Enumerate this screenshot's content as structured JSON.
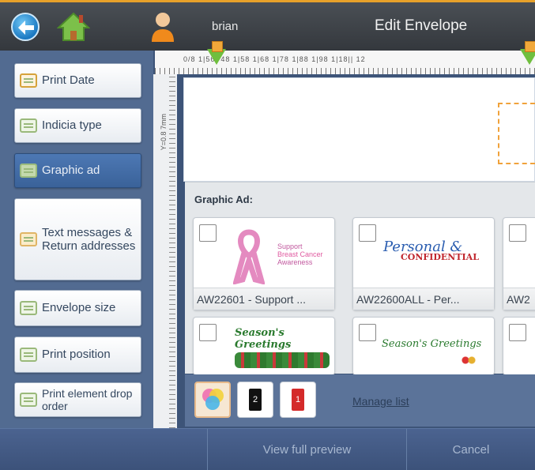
{
  "header": {
    "username": "brian",
    "title": "Edit Envelope"
  },
  "sidebar": {
    "items": [
      {
        "label": "Print Date",
        "icon": "calendar-icon"
      },
      {
        "label": "Indicia type",
        "icon": "indicia-icon"
      },
      {
        "label": "Graphic ad",
        "icon": "graphic-icon",
        "active": true
      },
      {
        "label": "Text messages & Return addresses",
        "icon": "text-icon"
      },
      {
        "label": "Envelope size",
        "icon": "envelope-icon"
      },
      {
        "label": "Print position",
        "icon": "position-icon"
      },
      {
        "label": "Print element drop order",
        "icon": "order-icon"
      }
    ]
  },
  "ruler": {
    "top_text": "0/8 1|56.  48 1|58 1|68 1|78 1|88 1|98  1|18|| 12",
    "left_text": "Y=0.8 7mm"
  },
  "graphic_panel": {
    "title": "Graphic Ad:",
    "cards": [
      {
        "caption": "AW22601 - Support ...",
        "art_lines": [
          "Support",
          "Breast Cancer",
          "Awareness"
        ]
      },
      {
        "caption": "AW22600ALL - Per...",
        "art_lines": [
          "Personal &",
          "CONFIDENTIAL"
        ]
      },
      {
        "caption": "AW2"
      },
      {
        "caption": "",
        "art_lines": [
          "Season's Greetings"
        ]
      },
      {
        "caption": "",
        "art_lines": [
          "Season's Greetings"
        ]
      },
      {
        "caption": ""
      }
    ]
  },
  "tools": {
    "btn2_label": "2",
    "btn3_label": "1",
    "manage_label": "Manage list"
  },
  "footer": {
    "preview_label": "View full preview",
    "cancel_label": "Cancel"
  },
  "colors": {
    "accent": "#e7a12a",
    "sidebar_bg": "#526b91",
    "active_item": "#3a6299",
    "footer_bg": "#3c527a"
  }
}
